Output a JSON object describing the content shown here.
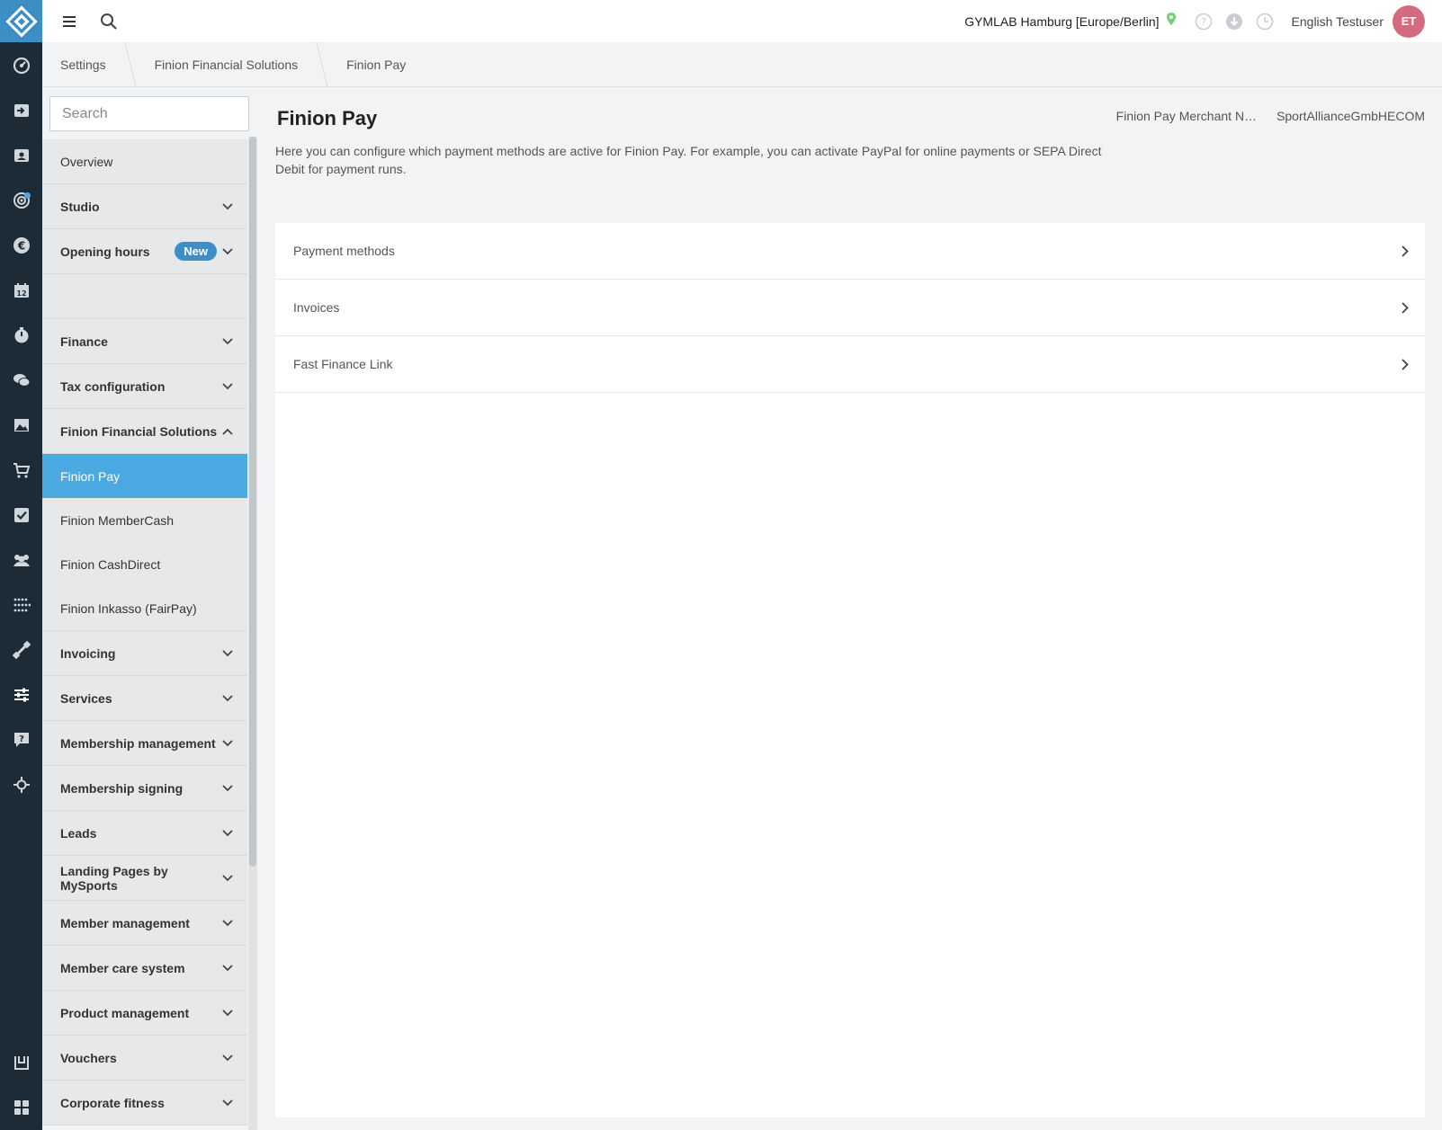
{
  "topbar": {
    "studio": "GYMLAB Hamburg [Europe/Berlin]",
    "user_name": "English Testuser",
    "avatar_initials": "ET"
  },
  "breadcrumb": [
    "Settings",
    "Finion Financial Solutions",
    "Finion Pay"
  ],
  "sidebar": {
    "search_placeholder": "Search",
    "items": [
      {
        "label": "Overview"
      },
      {
        "label": "Studio"
      },
      {
        "label": "Opening hours",
        "badge": "New"
      },
      {
        "label": "Finance"
      },
      {
        "label": "Tax configuration"
      },
      {
        "label": "Finion Financial Solutions"
      },
      {
        "label": "Finion Pay"
      },
      {
        "label": "Finion MemberCash"
      },
      {
        "label": "Finion CashDirect"
      },
      {
        "label": "Finion Inkasso (FairPay)"
      },
      {
        "label": "Invoicing"
      },
      {
        "label": "Services"
      },
      {
        "label": "Membership management"
      },
      {
        "label": "Membership signing"
      },
      {
        "label": "Leads"
      },
      {
        "label": "Landing Pages by MySports"
      },
      {
        "label": "Member management"
      },
      {
        "label": "Member care system"
      },
      {
        "label": "Product management"
      },
      {
        "label": "Vouchers"
      },
      {
        "label": "Corporate fitness"
      }
    ]
  },
  "main": {
    "title": "Finion Pay",
    "merchant_label": "Finion Pay Merchant N…",
    "merchant_value": "SportAllianceGmbHECOM",
    "description": "Here you can configure which payment methods are active for Finion Pay. For example, you can activate PayPal for online payments or SEPA Direct Debit for payment runs.",
    "rows": [
      {
        "label": "Payment methods"
      },
      {
        "label": "Invoices"
      },
      {
        "label": "Fast Finance Link"
      }
    ]
  },
  "colors": {
    "rail": "#1d2b36",
    "accent": "#3c8fc4",
    "active_item": "#4aa9e0",
    "avatar": "#d46a7e"
  },
  "icons": {
    "rail": [
      "dashboard-icon",
      "check-in-icon",
      "contacts-icon",
      "target-icon",
      "euro-icon",
      "calendar-icon",
      "timer-icon",
      "chat-icon",
      "image-icon",
      "cart-icon",
      "task-icon",
      "group-icon",
      "network-icon",
      "equipment-icon",
      "settings-sliders-icon",
      "help-icon",
      "integration-icon"
    ],
    "rail_bottom": [
      "shop-icon",
      "apps-icon"
    ]
  }
}
